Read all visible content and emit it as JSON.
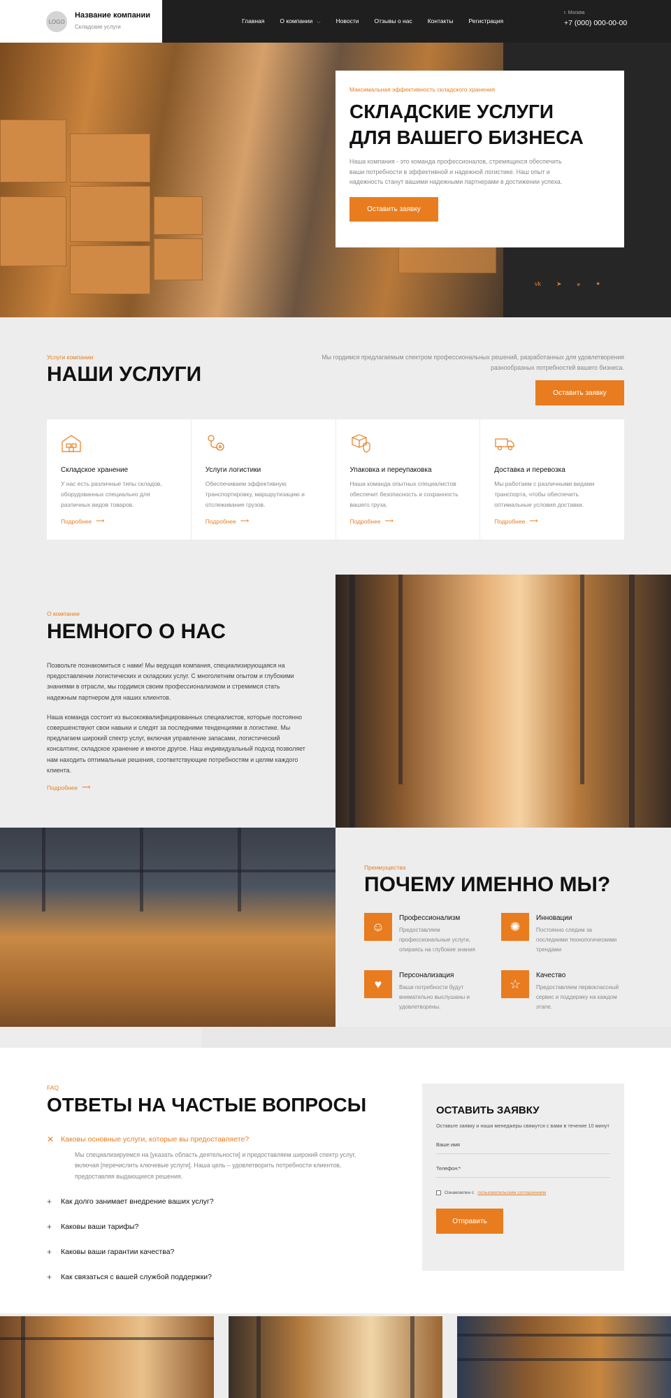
{
  "header": {
    "logo": "LOGO",
    "company_name": "Название компании",
    "company_sub": "Складские услуги",
    "nav": [
      "Главная",
      "О компании",
      "Новости",
      "Отзывы о нас",
      "Контакты",
      "Регистрация"
    ],
    "city": "г. Москва",
    "phone": "+7 (000) 000-00-00"
  },
  "hero": {
    "tag": "Максимальная эффективность складского хранения",
    "title_line1": "СКЛАДСКИЕ УСЛУГИ",
    "title_line2": "ДЛЯ ВАШЕГО БИЗНЕСА",
    "text": "Наша компания - это команда профессионалов, стремящихся обеспечить ваши потребности в эффективной и надежной логистике. Наш опыт и надежность станут вашими надежными партнерами в достижении успеха.",
    "button": "Оставить заявку",
    "socials": [
      "vk-icon",
      "telegram-icon",
      "odnoklassniki-icon",
      "twitter-icon"
    ]
  },
  "services": {
    "tag": "Услуги компании",
    "title": "НАШИ УСЛУГИ",
    "description": "Мы гордимся предлагаемым спектром профессиональных решений, разработанных для удовлетворения разнообразных потребностей вашего бизнеса.",
    "button": "Оставить заявку",
    "cards": [
      {
        "icon": "warehouse-icon",
        "title": "Складское хранение",
        "text": "У нас есть различные типы складов, оборудованных специально для различных видов товаров.",
        "more": "Подробнее"
      },
      {
        "icon": "route-pin-icon",
        "title": "Услуги логистики",
        "text": "Обеспечиваем эффективную транспортировку, маршрутизацию и отслеживание грузов.",
        "more": "Подробнее"
      },
      {
        "icon": "package-shield-icon",
        "title": "Упаковка и переупаковка",
        "text": "Наша команда опытных специалистов обеспечит безопасность и сохранность вашего груза.",
        "more": "Подробнее"
      },
      {
        "icon": "truck-icon",
        "title": "Доставка и перевозка",
        "text": "Мы работаем с различными видами транспорта, чтобы обеспечить оптимальные условия доставки.",
        "more": "Подробнее"
      }
    ]
  },
  "about": {
    "tag": "О компании",
    "title": "НЕМНОГО О НАС",
    "p1": "Позвольте познакомиться с нами! Мы ведущая компания, специализирующаяся на предоставлении логистических и складских услуг. С многолетним опытом и глубокими знаниями в отрасли, мы гордимся своим профессионализмом и стремимся стать надежным партнером для наших клиентов.",
    "p2": "Наша команда состоит из высококвалифицированных специалистов, которые постоянно совершенствуют свои навыки и следят за последними тенденциями в логистике. Мы предлагаем широкий спектр услуг, включая управление запасами, логистический консалтинг, складское хранение и многое другое. Наш индивидуальный подход позволяет нам находить оптимальные решения, соответствующие потребностям и целям каждого клиента.",
    "more": "Подробнее"
  },
  "why": {
    "tag": "Преимущества",
    "title": "ПОЧЕМУ ИМЕННО МЫ?",
    "features": [
      {
        "icon": "person-icon",
        "title": "Профессионализм",
        "text": "Предоставляем профессиональные услуги, опираясь на глубокие знания"
      },
      {
        "icon": "innovation-icon",
        "title": "Инновации",
        "text": "Постоянно следим за последними технологическими трендами"
      },
      {
        "icon": "hands-icon",
        "title": "Персонализация",
        "text": "Ваши потребности будут внимательно выслушаны и удовлетворены."
      },
      {
        "icon": "star-icon",
        "title": "Качество",
        "text": "Предоставляем первоклассный сервис и поддержку на каждом этапе."
      }
    ]
  },
  "faq": {
    "tag": "FAQ",
    "title": "ОТВЕТЫ НА ЧАСТЫЕ ВОПРОСЫ",
    "open_question": "Каковы основные услуги, которые вы предоставляете?",
    "open_answer": "Мы специализируемся на [указать область деятельности] и предоставляем широкий спектр услуг, включая [перечислить ключевые услуги]. Наша цель – удовлетворить потребности клиентов, предоставляя выдающиеся решения.",
    "questions": [
      "Как долго занимает внедрение ваших услуг?",
      "Каковы ваши тарифы?",
      "Каковы ваши гарантии качества?",
      "Как связаться с вашей службой поддержки?"
    ]
  },
  "form": {
    "title": "ОСТАВИТЬ ЗАЯВКУ",
    "subtitle": "Оставьте заявку и наши менеджеры свяжутся с вами в течение 10 минут",
    "name_label": "Ваше имя",
    "phone_label": "Телефон:*",
    "consent_text": "Ознакомлен с",
    "consent_link": "пользовательским соглашением",
    "button": "Отправить"
  },
  "colors": {
    "accent": "#e87c1e",
    "dark": "#1f1f1f",
    "background": "#ededed"
  }
}
